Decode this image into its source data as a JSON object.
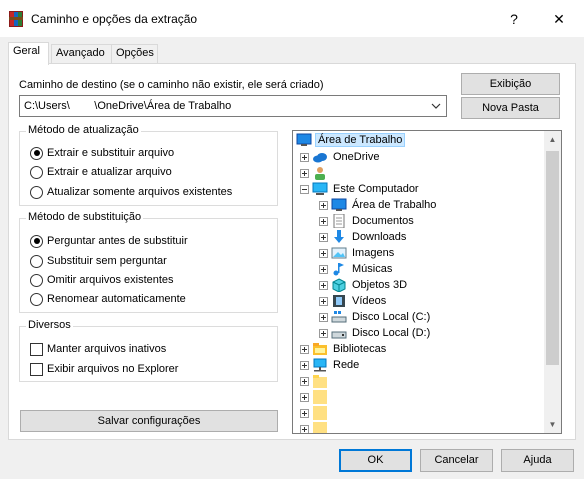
{
  "window": {
    "title": "Caminho e opções da extração",
    "help_label": "?",
    "close_label": "✕",
    "icon": "winrar-archive-icon"
  },
  "tabs": [
    {
      "label": "Geral",
      "active": true
    },
    {
      "label": "Avançado",
      "active": false
    },
    {
      "label": "Opções",
      "active": false
    }
  ],
  "destination": {
    "label": "Caminho de destino (se o caminho não existir, ele será criado)",
    "value": "C:\\Users\\        \\OneDrive\\Área de Trabalho"
  },
  "buttons": {
    "display": "Exibição",
    "new_folder": "Nova Pasta",
    "save_settings": "Salvar configurações",
    "ok": "OK",
    "cancel": "Cancelar",
    "help": "Ajuda"
  },
  "update_method": {
    "title": "Método de atualização",
    "options": [
      {
        "label": "Extrair e substituir arquivo",
        "selected": true
      },
      {
        "label": "Extrair e atualizar arquivo",
        "selected": false
      },
      {
        "label": "Atualizar somente arquivos existentes",
        "selected": false
      }
    ]
  },
  "overwrite_method": {
    "title": "Método de substituição",
    "options": [
      {
        "label": "Perguntar antes de substituir",
        "selected": true
      },
      {
        "label": "Substituir sem perguntar",
        "selected": false
      },
      {
        "label": "Omitir arquivos existentes",
        "selected": false
      },
      {
        "label": "Renomear automaticamente",
        "selected": false
      }
    ]
  },
  "misc": {
    "title": "Diversos",
    "options": [
      {
        "label": "Manter arquivos inativos",
        "checked": false
      },
      {
        "label": "Exibir arquivos no Explorer",
        "checked": false
      }
    ]
  },
  "tree": {
    "items": [
      {
        "label": "Área de Trabalho",
        "icon": "desktop-icon",
        "selected": true
      },
      {
        "label": "OneDrive",
        "icon": "cloud-icon"
      },
      {
        "label": "",
        "icon": "user-icon"
      },
      {
        "label": "Este Computador",
        "icon": "computer-icon"
      },
      {
        "label": "Área de Trabalho",
        "icon": "desktop-icon"
      },
      {
        "label": "Documentos",
        "icon": "documents-icon"
      },
      {
        "label": "Downloads",
        "icon": "downloads-icon"
      },
      {
        "label": "Imagens",
        "icon": "pictures-icon"
      },
      {
        "label": "Músicas",
        "icon": "music-icon"
      },
      {
        "label": "Objetos 3D",
        "icon": "objects-3d-icon"
      },
      {
        "label": "Vídeos",
        "icon": "videos-icon"
      },
      {
        "label": "Disco Local (C:)",
        "icon": "drive-icon"
      },
      {
        "label": "Disco Local (D:)",
        "icon": "drive-icon"
      },
      {
        "label": "Bibliotecas",
        "icon": "libraries-icon"
      },
      {
        "label": "Rede",
        "icon": "network-icon"
      },
      {
        "label": "",
        "icon": "folder-icon"
      },
      {
        "label": "",
        "icon": "folder-icon"
      },
      {
        "label": "",
        "icon": "folder-icon"
      },
      {
        "label": "",
        "icon": "folder-icon"
      }
    ]
  },
  "colors": {
    "accent": "#0078d7",
    "selection": "#cce8ff"
  }
}
